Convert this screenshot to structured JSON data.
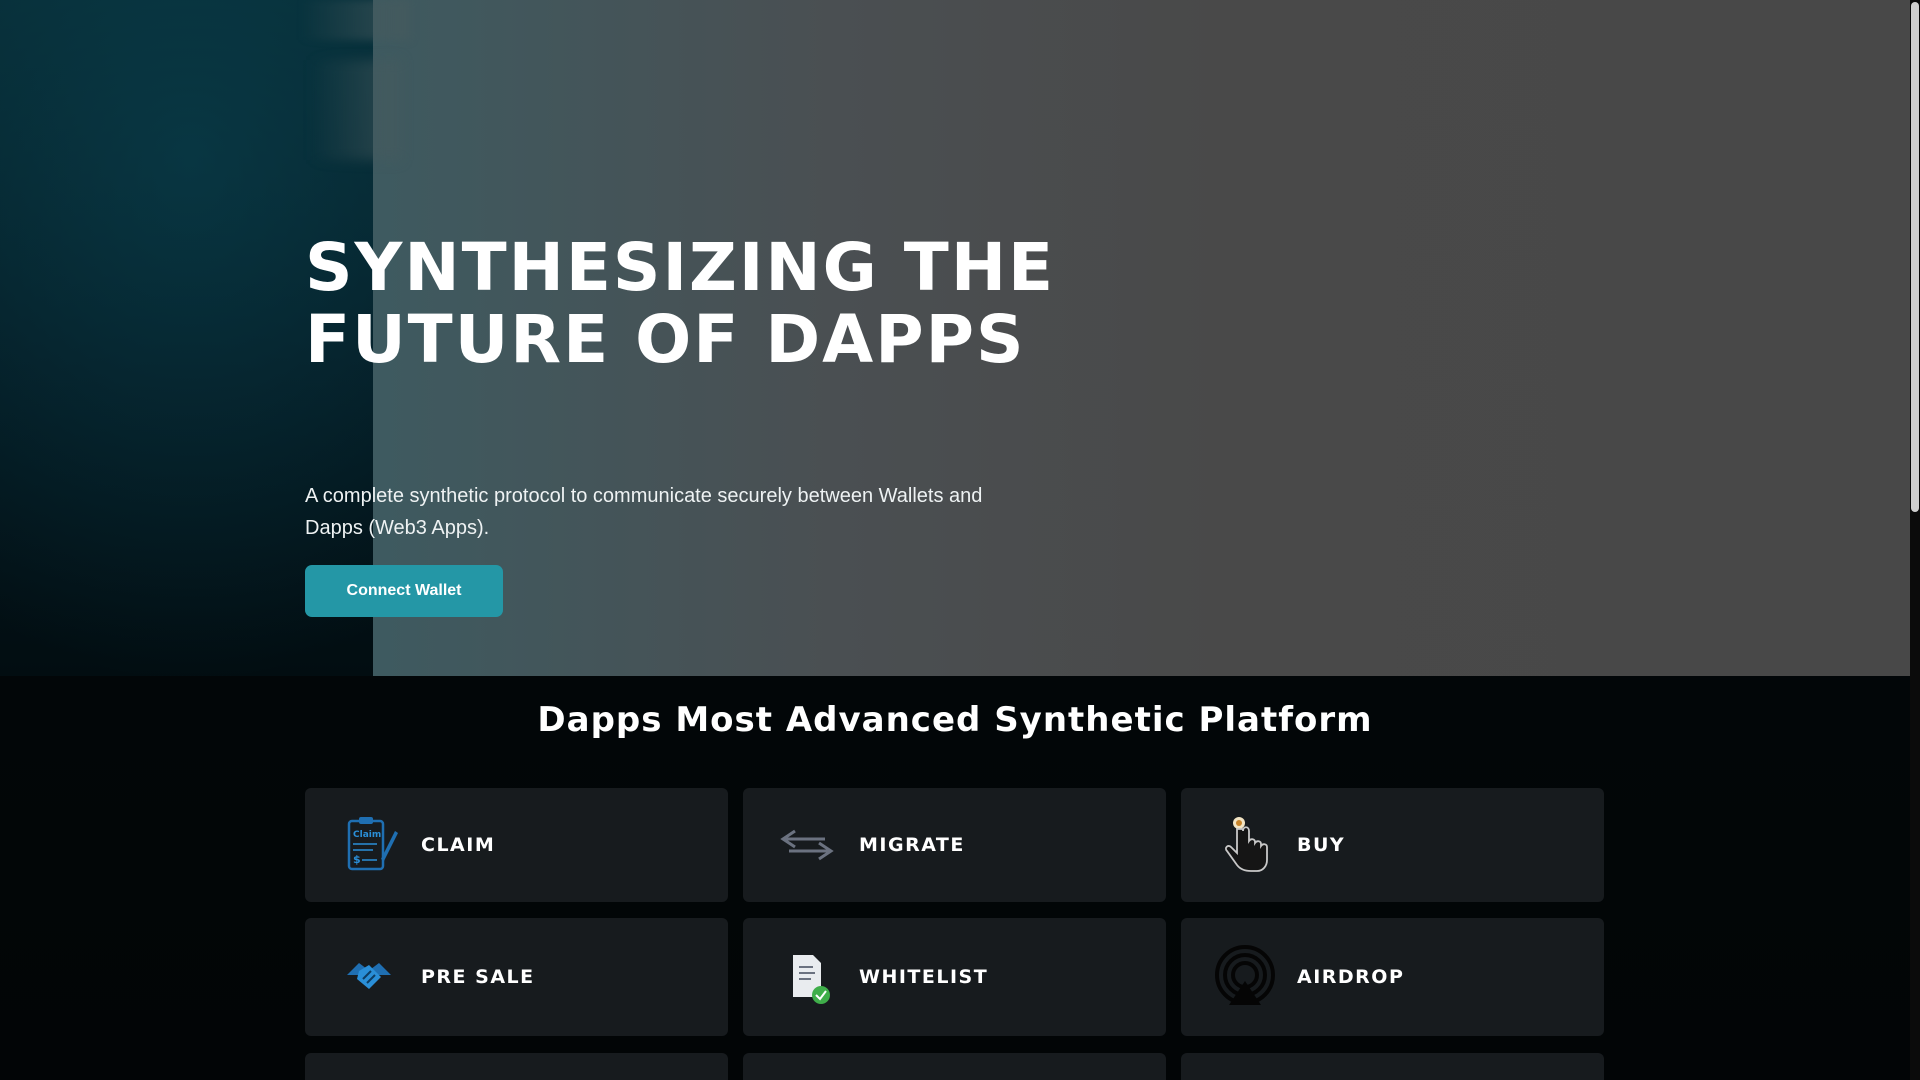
{
  "hero": {
    "title": "SYNTHESIZING THE FUTURE OF DAPPS",
    "subtitle": "A complete synthetic protocol to communicate securely between Wallets and Dapps (Web3 Apps).",
    "connect_label": "Connect Wallet"
  },
  "features": {
    "title": "Dapps Most Advanced Synthetic Platform",
    "cards": [
      {
        "label": "CLAIM",
        "icon": "claim-icon"
      },
      {
        "label": "MIGRATE",
        "icon": "migrate-icon"
      },
      {
        "label": "BUY",
        "icon": "buy-icon"
      },
      {
        "label": "PRE SALE",
        "icon": "handshake-icon"
      },
      {
        "label": "WHITELIST",
        "icon": "whitelist-icon"
      },
      {
        "label": "AIRDROP",
        "icon": "airdrop-icon"
      }
    ]
  },
  "icon_text": {
    "claim_tag": "Claim",
    "claim_dollar": "$"
  },
  "colors": {
    "accent": "#2497a6",
    "card_bg": "#171b1e",
    "background": "#020608"
  }
}
